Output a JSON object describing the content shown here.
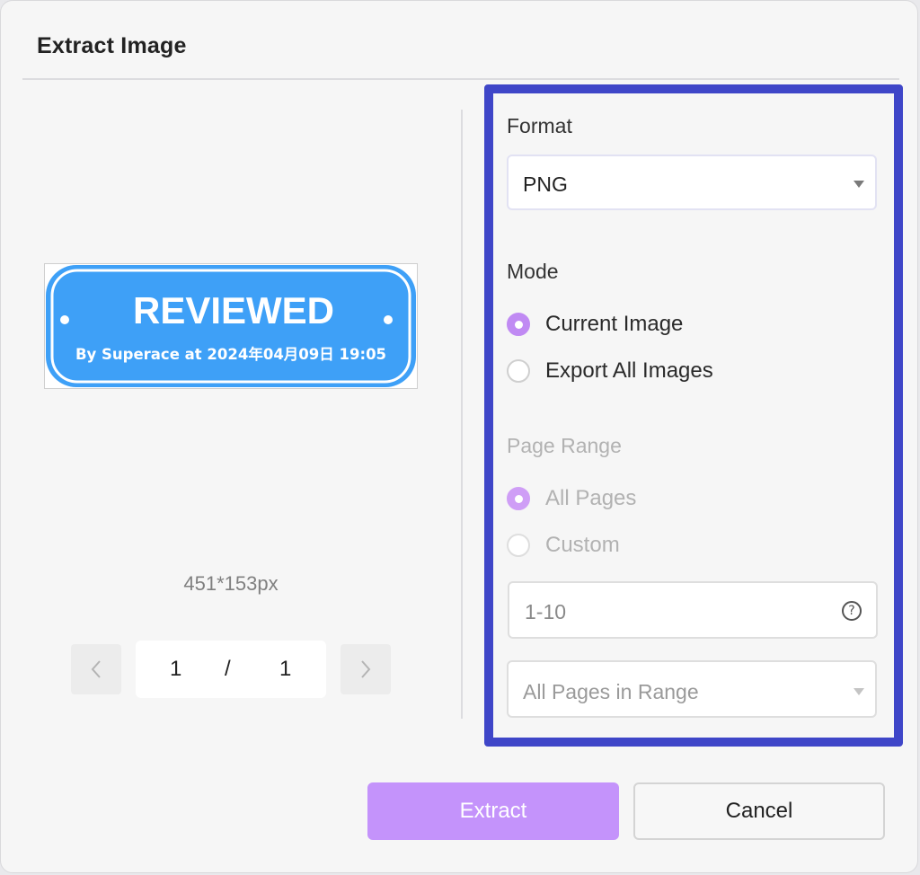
{
  "dialog": {
    "title": "Extract Image"
  },
  "preview": {
    "stamp_title": "REVIEWED",
    "stamp_subtitle": "By Superace at 2024年04月09日 19:05",
    "size_label": "451*153px",
    "stamp_color": "#3ea0f7"
  },
  "pager": {
    "current": "1",
    "separator": "/",
    "total": "1",
    "prev_icon": "chevron-left-icon",
    "next_icon": "chevron-right-icon"
  },
  "settings": {
    "format_label": "Format",
    "format_value": "PNG",
    "mode_label": "Mode",
    "mode_options": [
      {
        "label": "Current Image",
        "checked": true
      },
      {
        "label": "Export All Images",
        "checked": false
      }
    ],
    "page_range_label": "Page Range",
    "page_range_options": [
      {
        "label": "All Pages",
        "checked": true
      },
      {
        "label": "Custom",
        "checked": false
      }
    ],
    "range_input_value": "1-10",
    "help_icon": "question-circle-icon",
    "pages_subset_value": "All Pages in Range",
    "highlight_color": "#3f46c8",
    "accent_color": "#c08af3"
  },
  "footer": {
    "extract_label": "Extract",
    "cancel_label": "Cancel"
  }
}
